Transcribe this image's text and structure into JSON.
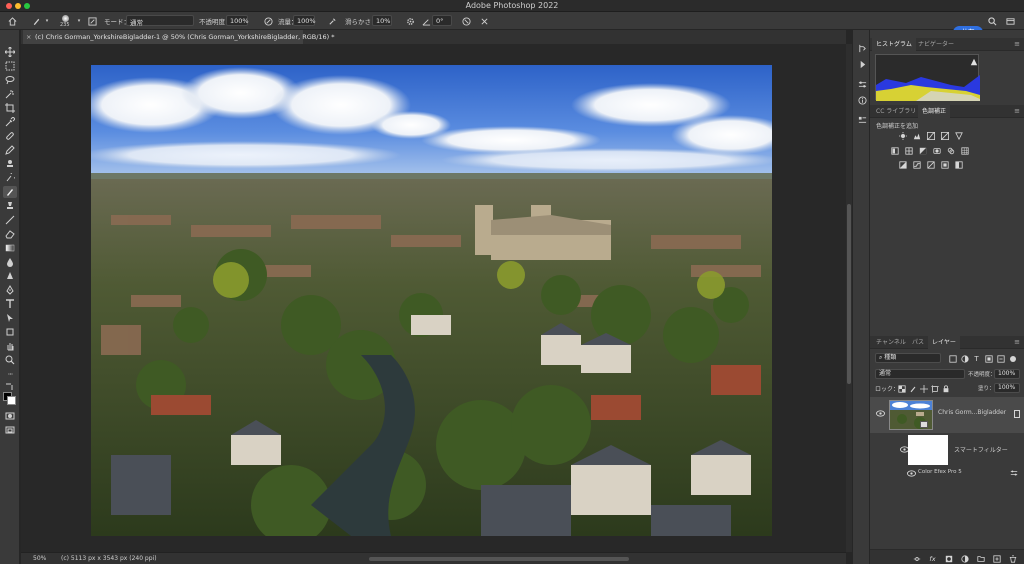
{
  "window": {
    "title": "Adobe Photoshop 2022"
  },
  "options_bar": {
    "brush_size": "235",
    "mode_label": "モード：",
    "mode_value": "通常",
    "opacity_label": "不透明度：",
    "opacity_value": "100%",
    "flow_label": "流量：",
    "flow_value": "100%",
    "smoothing_label": "滑らかさ：",
    "smoothing_value": "10%",
    "angle_value": "0°",
    "share_label": "共有"
  },
  "document": {
    "tab_title": "(c) Chris Gorman_YorkshireBigladder-1 @ 50% (Chris Gorman_YorkshireBigladder, RGB/16) *"
  },
  "status": {
    "zoom": "50%",
    "info": "(c) 5113 px x 3543 px (240 ppi)"
  },
  "panels": {
    "histogram_tabs": [
      "ヒストグラム",
      "ナビゲーター"
    ],
    "adjust_tabs": [
      "CC ライブラリ",
      "色調補正"
    ],
    "adjust_label": "色調補正を追加",
    "layers_tabs": [
      "チャンネル",
      "パス",
      "レイヤー"
    ],
    "layers": {
      "filter_kind": "種類",
      "blend_mode": "通常",
      "opacity_label": "不透明度：",
      "opacity_value": "100%",
      "lock_label": "ロック：",
      "fill_label": "塗り：",
      "fill_value": "100%",
      "layer_name": "Chris Gorm...Bigladder",
      "smart_filter_label": "スマートフィルター",
      "filter_name": "Color Efex Pro 5"
    }
  },
  "colors": {
    "accent": "#2f6fe0",
    "panel_bg": "#3a3a3a",
    "canvas_bg": "#282828"
  }
}
